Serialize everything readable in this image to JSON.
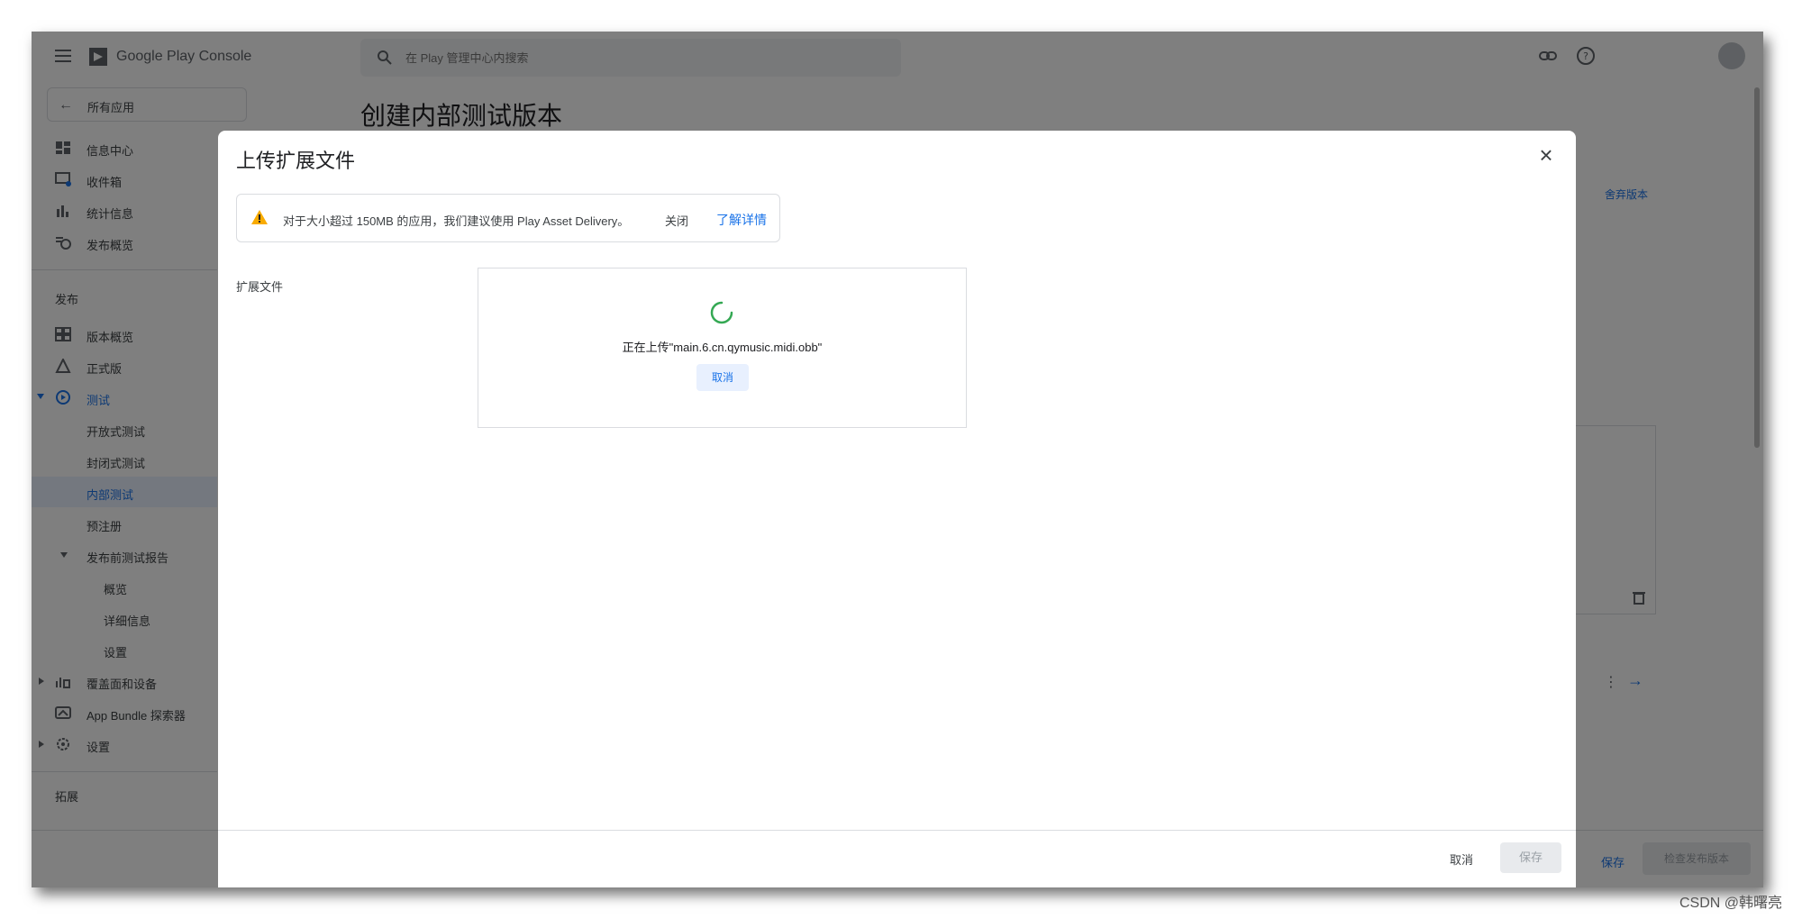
{
  "topbar": {
    "logo_word": "Google Play",
    "logo_word2": "Console",
    "search_placeholder": "在 Play 管理中心内搜索"
  },
  "sidebar": {
    "all_apps": "所有应用",
    "items": [
      {
        "label": "信息中心",
        "icon": "dashboard-icon"
      },
      {
        "label": "收件箱",
        "icon": "inbox-icon"
      },
      {
        "label": "统计信息",
        "icon": "bar-chart-icon"
      },
      {
        "label": "发布概览",
        "icon": "publishing-overview-icon"
      }
    ],
    "release_section": "发布",
    "release_items": [
      {
        "label": "版本概览",
        "icon": "releases-overview-icon"
      },
      {
        "label": "正式版",
        "icon": "production-icon"
      },
      {
        "label": "测试",
        "icon": "testing-icon"
      },
      {
        "label": "开放式测试"
      },
      {
        "label": "封闭式测试"
      },
      {
        "label": "内部测试"
      },
      {
        "label": "预注册"
      },
      {
        "label": "发布前测试报告"
      },
      {
        "label": "概览"
      },
      {
        "label": "详细信息"
      },
      {
        "label": "设置"
      },
      {
        "label": "覆盖面和设备",
        "icon": "reach-devices-icon"
      },
      {
        "label": "App Bundle 探索器",
        "icon": "app-bundle-icon"
      },
      {
        "label": "设置",
        "icon": "settings-gear-icon"
      }
    ],
    "grow_section": "拓展"
  },
  "page": {
    "title": "创建内部测试版本",
    "discard_release": "舍弃版本",
    "save": "保存",
    "review_release": "检查发布版本"
  },
  "dialog": {
    "title": "上传扩展文件",
    "alert_text": "对于大小超过 150MB 的应用，我们建议使用 Play Asset Delivery。",
    "alert_dismiss": "关闭",
    "alert_learn_more": "了解详情",
    "field_label": "扩展文件",
    "upload_status": "正在上传\"main.6.cn.qymusic.midi.obb\"",
    "upload_cancel": "取消",
    "footer_cancel": "取消",
    "footer_save": "保存"
  },
  "watermark": "CSDN @韩曙亮",
  "colors": {
    "accent": "#1a73e8",
    "spinner": "#34a853",
    "warning": "#f9ab00"
  }
}
